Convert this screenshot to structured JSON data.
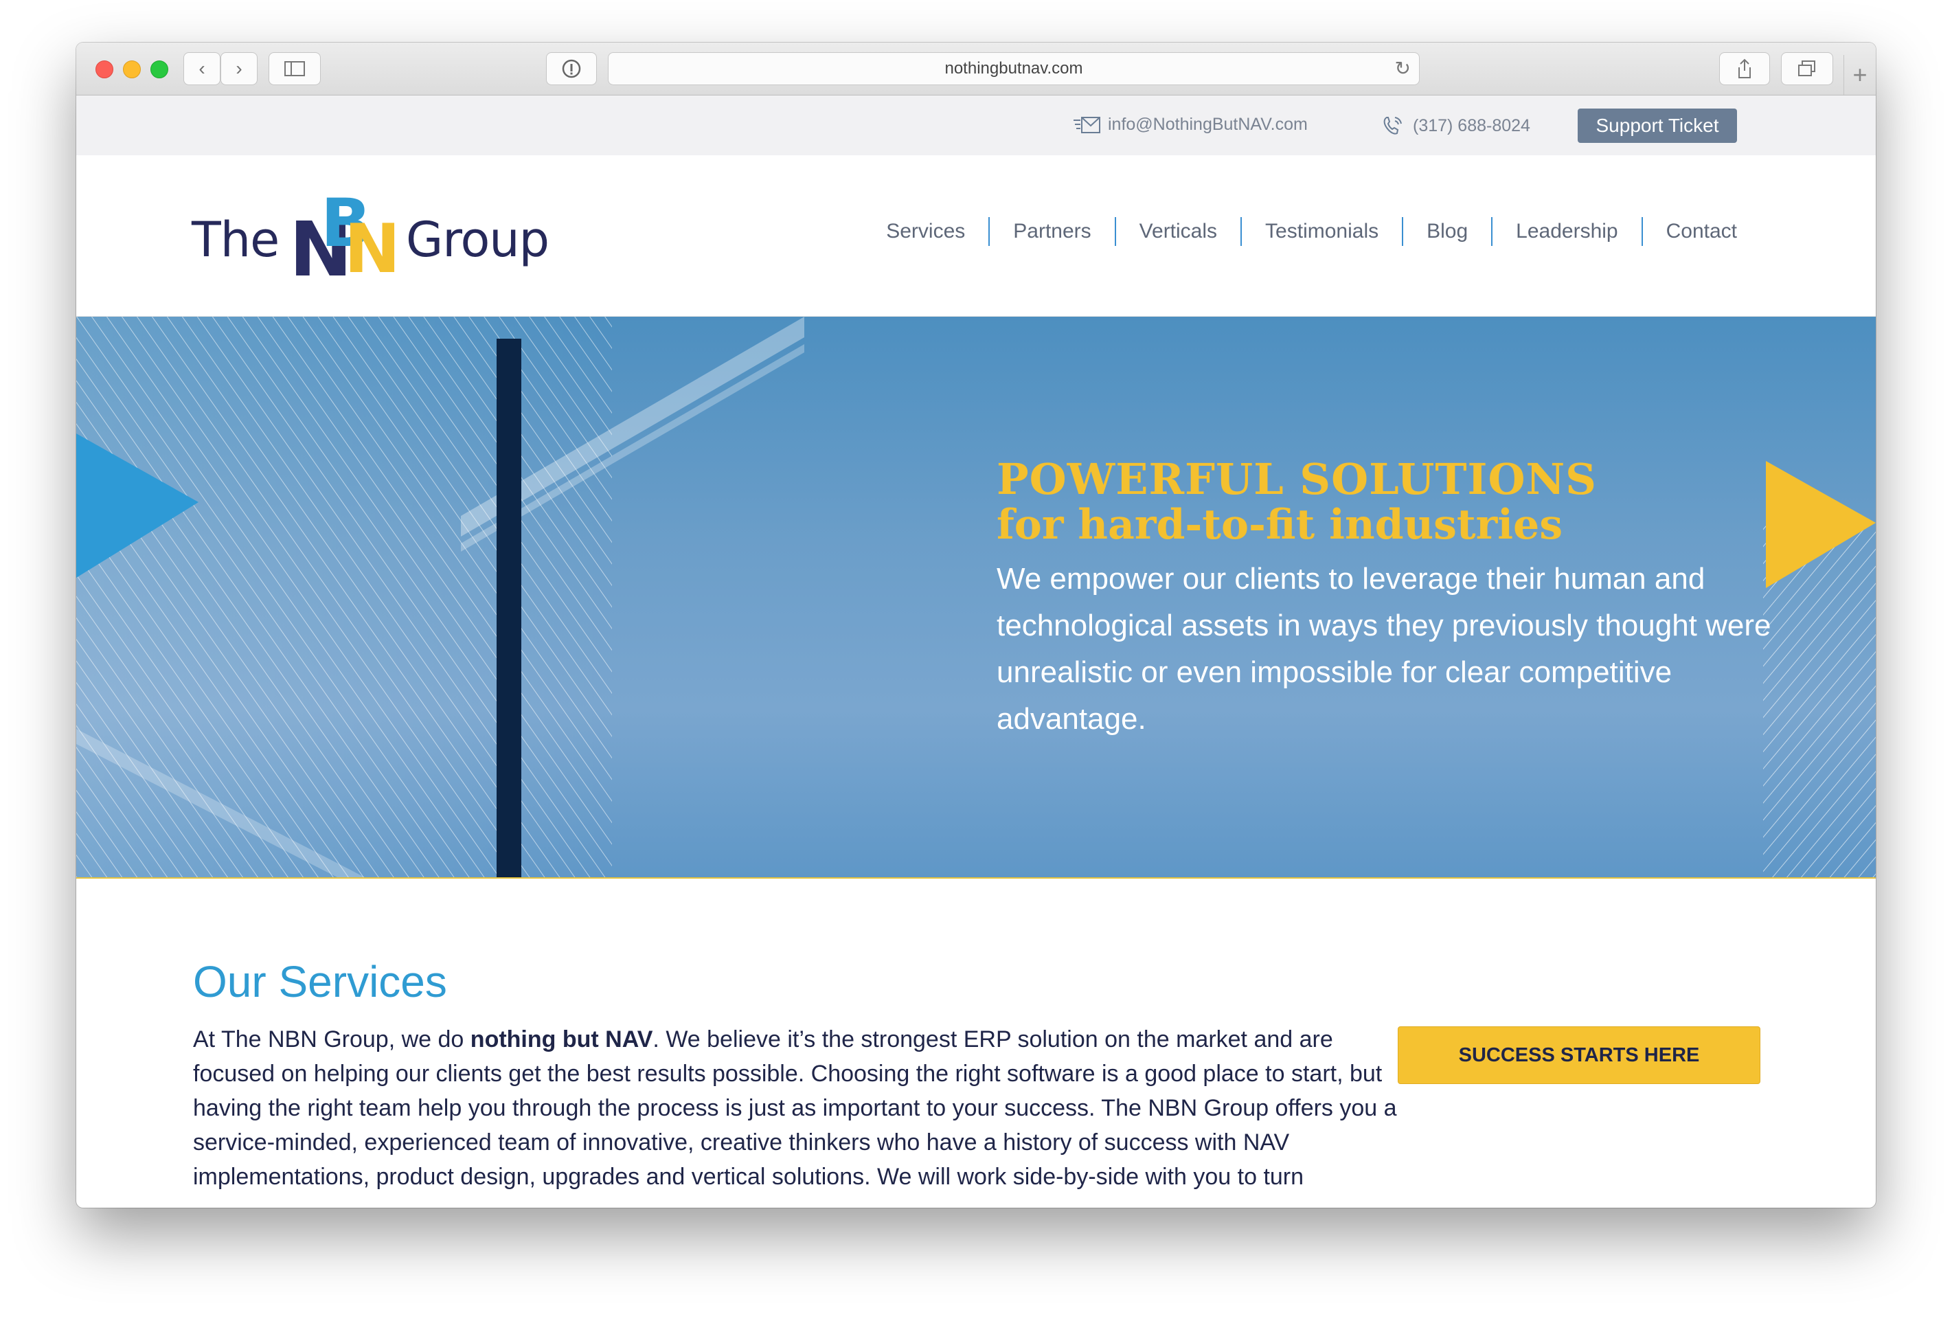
{
  "browser": {
    "url": "nothingbutnav.com",
    "back_label": "‹",
    "forward_label": "›"
  },
  "utility": {
    "email": "info@NothingButNAV.com",
    "phone": "(317) 688-8024",
    "support_label": "Support Ticket"
  },
  "logo": {
    "the": "The",
    "group": "Group",
    "mark_letters": [
      "N",
      "B",
      "N"
    ]
  },
  "nav": {
    "items": [
      "Services",
      "Partners",
      "Verticals",
      "Testimonials",
      "Blog",
      "Leadership",
      "Contact"
    ]
  },
  "hero": {
    "title": "POWERFUL SOLUTIONS",
    "subtitle": "for hard-to-fit industries",
    "body": "We empower our clients to leverage their human and technological assets in ways they previously thought were unrealistic or even impossible for clear competitive advantage."
  },
  "services": {
    "title": "Our Services",
    "body_prefix": "At The NBN Group, we do ",
    "body_bold": "nothing but NAV",
    "body_rest": ". We believe it’s the strongest ERP solution on the market and are focused on helping our clients get the best results possible. Choosing the right software is a good place to start, but having the right team help you through the process is just as important to your success. The NBN Group offers you a service-minded, experienced team of innovative, creative thinkers who have a history of success with NAV implementations, product design, upgrades and vertical solutions. We will work side-by-side with you to turn ",
    "cta_label": "SUCCESS STARTS HERE"
  },
  "colors": {
    "brand_navy": "#26295a",
    "accent_blue": "#2f9bd2",
    "accent_yellow": "#f5c231",
    "support_button": "#6a7d95"
  }
}
